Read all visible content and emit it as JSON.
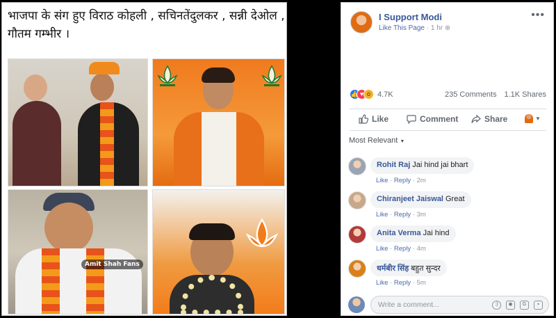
{
  "image_panel": {
    "caption": "भाजपा के संग हुए विराठ कोहली , सचिनतेंदुलकर , सन्नी देओल , गौतम गम्भीर ।",
    "watermark": "Amit Shah Fans"
  },
  "post": {
    "page_name": "I Support Modi",
    "like_link": "Like This Page",
    "time": "1 hr",
    "reactions_count": "4.7K",
    "comments_count": "235 Comments",
    "shares_count": "1.1K Shares",
    "actions": {
      "like": "Like",
      "comment": "Comment",
      "share": "Share"
    },
    "sort_label": "Most Relevant"
  },
  "comments": [
    {
      "author": "Rohit Raj",
      "text": "Jai hind jai bhart",
      "like": "Like",
      "reply": "Reply",
      "time": "2m",
      "avatar_color": "#9aa4b3"
    },
    {
      "author": "Chiranjeet Jaiswal",
      "text": "Great",
      "like": "Like",
      "reply": "Reply",
      "time": "3m",
      "avatar_color": "#c7a88a"
    },
    {
      "author": "Anita Verma",
      "text": "Jai hind",
      "like": "Like",
      "reply": "Reply",
      "time": "4m",
      "avatar_color": "#b33a3a"
    },
    {
      "author": "धर्मबीर सिंह",
      "text": "बहुत सुन्दर",
      "like": "Like",
      "reply": "Reply",
      "time": "5m",
      "avatar_color": "#d9801a"
    }
  ],
  "composer": {
    "placeholder": "Write a comment..."
  },
  "colors": {
    "link_blue": "#385898",
    "bjp_saffron": "#f37c1a",
    "like_blue": "#2078f4"
  }
}
